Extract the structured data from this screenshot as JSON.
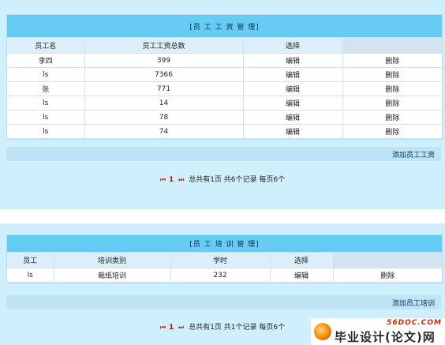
{
  "salary": {
    "title": "[员 工 工 资 管 理]",
    "headers": [
      "员工名",
      "员工工资总数",
      "选择",
      ""
    ],
    "rows": [
      {
        "name": "李四",
        "total": "399",
        "edit": "编辑",
        "delete": "删除"
      },
      {
        "name": "ls",
        "total": "7366",
        "edit": "编辑",
        "delete": "删除"
      },
      {
        "name": "张",
        "total": "771",
        "edit": "编辑",
        "delete": "删除"
      },
      {
        "name": "ls",
        "total": "14",
        "edit": "编辑",
        "delete": "删除"
      },
      {
        "name": "ls",
        "total": "78",
        "edit": "编辑",
        "delete": "删除"
      },
      {
        "name": "ls",
        "total": "74",
        "edit": "编辑",
        "delete": "删除"
      }
    ],
    "add_label": "添加员工工资",
    "pager": {
      "first_icon": "⏮",
      "page": "1",
      "next_icon": "⏭",
      "text": "总共有1页  共6个记录  每页6个"
    }
  },
  "training": {
    "title": "[员 工 培 训 管 理]",
    "headers": [
      "员工",
      "培训类别",
      "学时",
      "选择",
      ""
    ],
    "rows": [
      {
        "employee": "ls",
        "category": "裁纸培训",
        "hours": "232",
        "edit": "编辑",
        "delete": "删除"
      }
    ],
    "add_label": "添加员工培训",
    "pager": {
      "first_icon": "⏮",
      "page": "1",
      "next_icon": "⏭",
      "text": "总共有1页  共1个记录  每页6个"
    }
  },
  "watermark": {
    "url": "56DOC.COM",
    "title": "毕业设计(论文)网"
  },
  "colors": {
    "panel_bg": "#cfeffd",
    "title_bar": "#66ccf5",
    "header_row": "#dbeefa",
    "pager_accent": "#e00000"
  }
}
